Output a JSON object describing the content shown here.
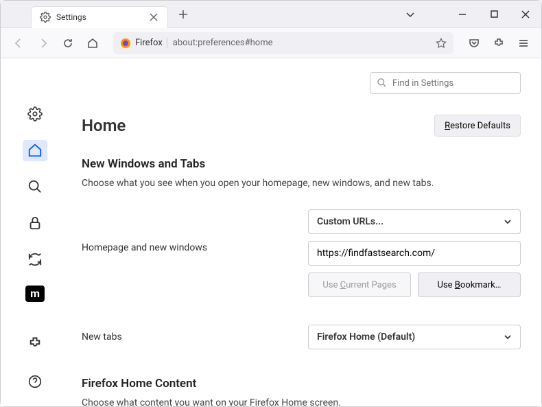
{
  "tab": {
    "title": "Settings"
  },
  "urlbar": {
    "firefox_label": "Firefox",
    "url": "about:preferences#home"
  },
  "search": {
    "placeholder": "Find in Settings"
  },
  "page": {
    "title": "Home",
    "restore": "Restore Defaults"
  },
  "section1": {
    "heading": "New Windows and Tabs",
    "desc": "Choose what you see when you open your homepage, new windows, and new tabs."
  },
  "homepage_row": {
    "label": "Homepage and new windows",
    "select": "Custom URLs...",
    "url_value": "https://findfastsearch.com/",
    "use_current": "Use Current Pages",
    "use_bookmark": "Use Bookmark…"
  },
  "newtabs_row": {
    "label": "New tabs",
    "select": "Firefox Home (Default)"
  },
  "section2": {
    "heading": "Firefox Home Content",
    "desc": "Choose what content you want on your Firefox Home screen."
  }
}
